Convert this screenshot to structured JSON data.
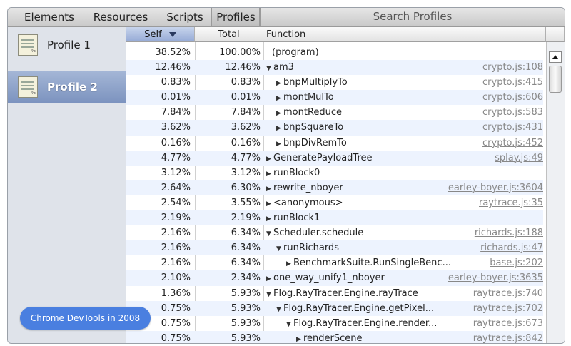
{
  "tabs": [
    "Elements",
    "Resources",
    "Scripts",
    "Profiles"
  ],
  "search": {
    "label": "Search Profiles"
  },
  "sidebar": {
    "profiles": [
      {
        "label": "Profile 1",
        "selected": false
      },
      {
        "label": "Profile 2",
        "selected": true
      }
    ]
  },
  "columns": {
    "self": "Self",
    "total": "Total",
    "function": "Function"
  },
  "rows": [
    {
      "self": "38.52%",
      "total": "100.00%",
      "indent": 0,
      "tri": "",
      "func": "(program)",
      "link": ""
    },
    {
      "self": "12.46%",
      "total": "12.46%",
      "indent": 0,
      "tri": "▼",
      "func": "am3",
      "link": "crypto.js:108"
    },
    {
      "self": "0.83%",
      "total": "0.83%",
      "indent": 1,
      "tri": "▶",
      "func": "bnpMultiplyTo",
      "link": "crypto.js:415"
    },
    {
      "self": "0.01%",
      "total": "0.01%",
      "indent": 1,
      "tri": "▶",
      "func": "montMulTo",
      "link": "crypto.js:606"
    },
    {
      "self": "7.84%",
      "total": "7.84%",
      "indent": 1,
      "tri": "▶",
      "func": "montReduce",
      "link": "crypto.js:583"
    },
    {
      "self": "3.62%",
      "total": "3.62%",
      "indent": 1,
      "tri": "▶",
      "func": "bnpSquareTo",
      "link": "crypto.js:431"
    },
    {
      "self": "0.16%",
      "total": "0.16%",
      "indent": 1,
      "tri": "▶",
      "func": "bnpDivRemTo",
      "link": "crypto.js:452"
    },
    {
      "self": "4.77%",
      "total": "4.77%",
      "indent": 0,
      "tri": "▶",
      "func": "GeneratePayloadTree",
      "link": "splay.js:49"
    },
    {
      "self": "3.12%",
      "total": "3.12%",
      "indent": 0,
      "tri": "▶",
      "func": "runBlock0",
      "link": ""
    },
    {
      "self": "2.64%",
      "total": "6.30%",
      "indent": 0,
      "tri": "▶",
      "func": "rewrite_nboyer",
      "link": "earley-boyer.js:3604"
    },
    {
      "self": "2.54%",
      "total": "3.55%",
      "indent": 0,
      "tri": "▶",
      "func": "<anonymous>",
      "link": "raytrace.js:35"
    },
    {
      "self": "2.19%",
      "total": "2.19%",
      "indent": 0,
      "tri": "▶",
      "func": "runBlock1",
      "link": ""
    },
    {
      "self": "2.16%",
      "total": "6.34%",
      "indent": 0,
      "tri": "▼",
      "func": "Scheduler.schedule",
      "link": "richards.js:188"
    },
    {
      "self": "2.16%",
      "total": "6.34%",
      "indent": 1,
      "tri": "▼",
      "func": "runRichards",
      "link": "richards.js:47"
    },
    {
      "self": "2.16%",
      "total": "6.34%",
      "indent": 2,
      "tri": "▶",
      "func": "BenchmarkSuite.RunSingleBenc...",
      "link": "base.js:202"
    },
    {
      "self": "2.10%",
      "total": "2.34%",
      "indent": 0,
      "tri": "▶",
      "func": "one_way_unify1_nboyer",
      "link": "earley-boyer.js:3635"
    },
    {
      "self": "1.36%",
      "total": "5.93%",
      "indent": 0,
      "tri": "▼",
      "func": "Flog.RayTracer.Engine.rayTrace",
      "link": "raytrace.js:740"
    },
    {
      "self": "0.75%",
      "total": "5.93%",
      "indent": 1,
      "tri": "▼",
      "func": "Flog.RayTracer.Engine.getPixel...",
      "link": "raytrace.js:702"
    },
    {
      "self": "0.75%",
      "total": "5.93%",
      "indent": 2,
      "tri": "▼",
      "func": "Flog.RayTracer.Engine.render...",
      "link": "raytrace.js:673"
    },
    {
      "self": "0.75%",
      "total": "5.93%",
      "indent": 3,
      "tri": "▶",
      "func": "renderScene",
      "link": "raytrace.js:842"
    }
  ],
  "badge": {
    "label": "Chrome DevTools in 2008"
  },
  "colors": {
    "selection": "#7c93bf",
    "badge": "#4a7fe0",
    "link": "#888888"
  }
}
